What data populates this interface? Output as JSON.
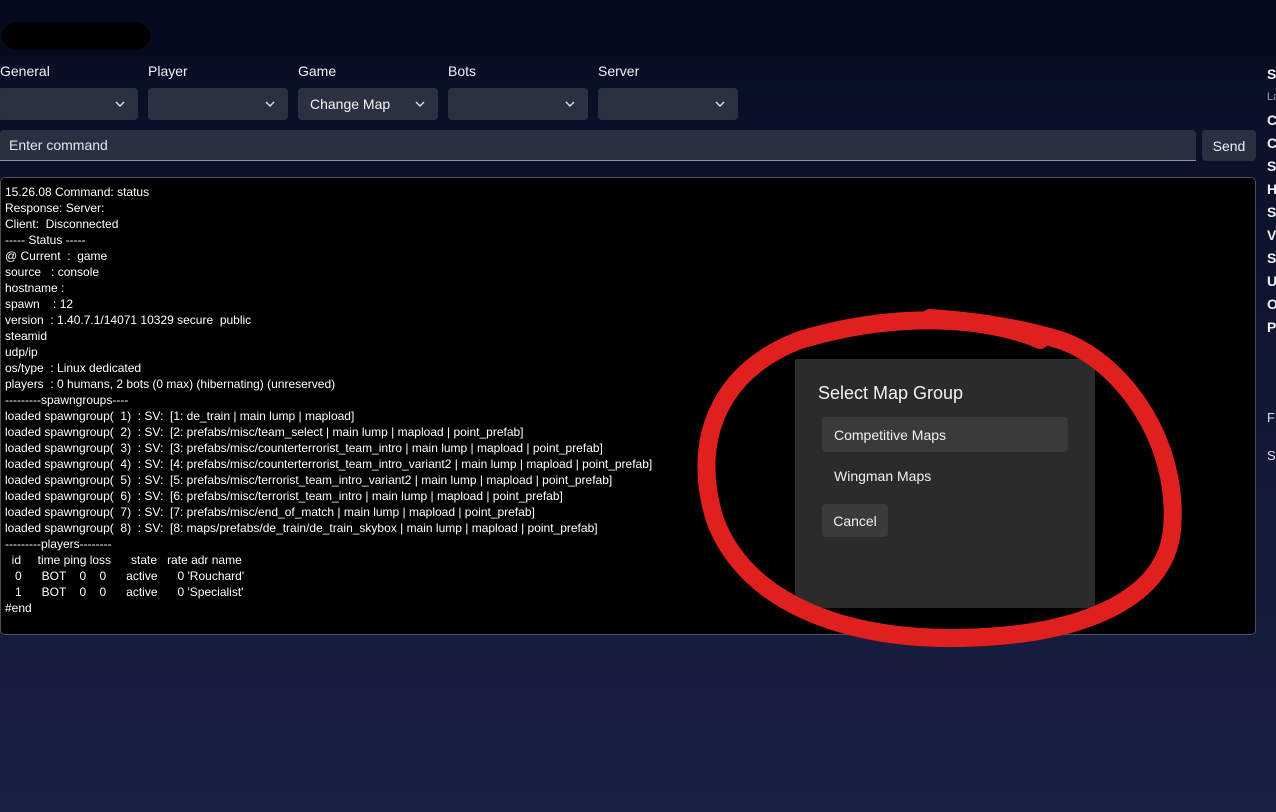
{
  "dropdowns": [
    {
      "label": "General",
      "value": ""
    },
    {
      "label": "Player",
      "value": ""
    },
    {
      "label": "Game",
      "value": "Change Map"
    },
    {
      "label": "Bots",
      "value": ""
    },
    {
      "label": "Server",
      "value": ""
    }
  ],
  "command": {
    "placeholder": "Enter command",
    "send_label": "Send"
  },
  "console": {
    "lines": [
      "15.26.08 Command: status",
      "Response: Server:",
      "Client:  Disconnected",
      "----- Status -----",
      "@ Current  :  game",
      "source   : console",
      "hostname :",
      "spawn    : 12",
      "version  : 1.40.7.1/14071 10329 secure  public",
      "steamid",
      "udp/ip",
      "os/type  : Linux dedicated",
      "players  : 0 humans, 2 bots (0 max) (hibernating) (unreserved)",
      "---------spawngroups----",
      "loaded spawngroup(  1)  : SV:  [1: de_train | main lump | mapload]",
      "loaded spawngroup(  2)  : SV:  [2: prefabs/misc/team_select | main lump | mapload | point_prefab]",
      "loaded spawngroup(  3)  : SV:  [3: prefabs/misc/counterterrorist_team_intro | main lump | mapload | point_prefab]",
      "loaded spawngroup(  4)  : SV:  [4: prefabs/misc/counterterrorist_team_intro_variant2 | main lump | mapload | point_prefab]",
      "loaded spawngroup(  5)  : SV:  [5: prefabs/misc/terrorist_team_intro_variant2 | main lump | mapload | point_prefab]",
      "loaded spawngroup(  6)  : SV:  [6: prefabs/misc/terrorist_team_intro | main lump | mapload | point_prefab]",
      "loaded spawngroup(  7)  : SV:  [7: prefabs/misc/end_of_match | main lump | mapload | point_prefab]",
      "loaded spawngroup(  8)  : SV:  [8: maps/prefabs/de_train/de_train_skybox | main lump | mapload | point_prefab]",
      "---------players--------",
      "  id     time ping loss      state   rate adr name",
      "   0      BOT    0    0      active      0 'Rouchard'",
      "   1      BOT    0    0      active      0 'Specialist'",
      "#end"
    ]
  },
  "dialog": {
    "title": "Select Map Group",
    "options": [
      "Competitive Maps",
      "Wingman Maps"
    ],
    "cancel_label": "Cancel"
  },
  "right_panel": {
    "items": [
      "S",
      "C",
      "C",
      "S",
      "H",
      "S",
      "V",
      "S",
      "U",
      "O",
      "P"
    ],
    "sub": "La",
    "extra": [
      "F",
      "S"
    ]
  },
  "colors": {
    "annotation": "#e0201e",
    "console_bg": "#000000",
    "dialog_bg": "#2b2b2b",
    "control_bg": "#2c3142"
  }
}
